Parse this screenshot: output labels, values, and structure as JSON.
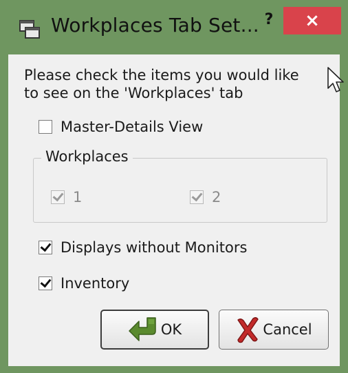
{
  "window": {
    "title": "Workplaces Tab Set...",
    "help_label": "?",
    "close_label": "×"
  },
  "intro": {
    "line1": "Please check the items you would like",
    "line2": "to see on the 'Workplaces' tab"
  },
  "options": {
    "master_details": {
      "label": "Master-Details View",
      "checked": false
    },
    "displays_without_monitors": {
      "label": "Displays without Monitors",
      "checked": true
    },
    "inventory": {
      "label": "Inventory",
      "checked": true
    }
  },
  "workplaces_group": {
    "title": "Workplaces",
    "items": [
      {
        "label": "1",
        "checked": true,
        "enabled": false
      },
      {
        "label": "2",
        "checked": true,
        "enabled": false
      }
    ]
  },
  "buttons": {
    "ok_label": "OK",
    "cancel_label": "Cancel"
  },
  "icons": {
    "app": "workplaces-window-icon",
    "ok": "green-arrow-icon",
    "cancel": "red-x-icon",
    "cursor": "mouse-pointer-icon"
  },
  "colors": {
    "window_frame": "#6f9660",
    "close_button": "#d9434b",
    "dialog_background": "#f0f0f0"
  }
}
